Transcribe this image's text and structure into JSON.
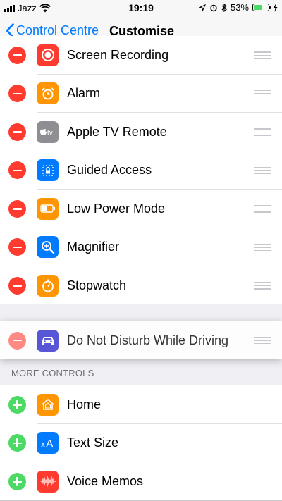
{
  "status_bar": {
    "carrier": "Jazz",
    "time": "19:19",
    "battery_percent": "53%",
    "battery_level": 0.53,
    "battery_color": "#4cd964"
  },
  "nav": {
    "back_label": "Control Centre",
    "title": "Customise"
  },
  "include": {
    "items": [
      {
        "label": "Screen Recording",
        "icon": "screen-recording-icon",
        "color": "#ff3b30"
      },
      {
        "label": "Alarm",
        "icon": "alarm-icon",
        "color": "#ff9500"
      },
      {
        "label": "Apple TV Remote",
        "icon": "apple-tv-icon",
        "color": "#8e8e93"
      },
      {
        "label": "Guided Access",
        "icon": "guided-access-icon",
        "color": "#007aff"
      },
      {
        "label": "Low Power Mode",
        "icon": "battery-icon",
        "color": "#ff9500"
      },
      {
        "label": "Magnifier",
        "icon": "magnifier-icon",
        "color": "#007aff"
      },
      {
        "label": "Stopwatch",
        "icon": "stopwatch-icon",
        "color": "#ff9500"
      }
    ]
  },
  "dragging_item": {
    "label": "Do Not Disturb While Driving",
    "icon": "car-icon",
    "color": "#5856d6"
  },
  "more_controls": {
    "header": "MORE CONTROLS",
    "items": [
      {
        "label": "Home",
        "icon": "home-icon",
        "color": "#ff9500"
      },
      {
        "label": "Text Size",
        "icon": "text-size-icon",
        "color": "#007aff"
      },
      {
        "label": "Voice Memos",
        "icon": "voice-memos-icon",
        "color": "#ff3b30"
      }
    ]
  }
}
